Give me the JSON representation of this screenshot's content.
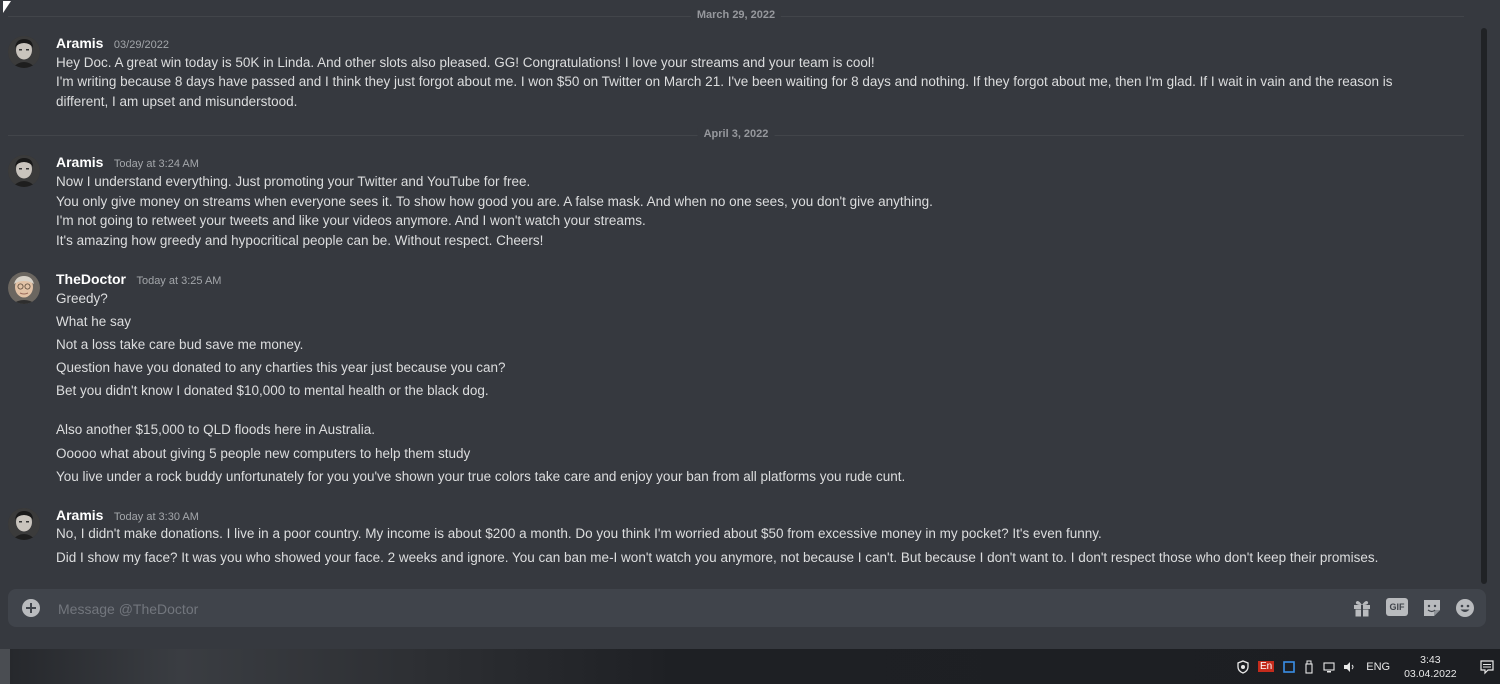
{
  "dividers": [
    "March 29, 2022",
    "April 3, 2022"
  ],
  "messages": [
    {
      "author": "Aramis",
      "timestamp": "03/29/2022",
      "lines": [
        "Hey Doc. A great win today is 50K in Linda. And other slots also pleased. GG! Congratulations! I love your streams and your team is cool!",
        "I'm writing because 8 days have passed and I think they just forgot about me. I won $50 on Twitter on March 21. I've been waiting for 8 days and nothing. If they forgot about me, then I'm glad. If I wait in vain and the reason is different, I am upset and misunderstood."
      ]
    },
    {
      "author": "Aramis",
      "timestamp": "Today at 3:24 AM",
      "lines": [
        "Now I understand everything. Just promoting your Twitter and YouTube for free.",
        "You only give money on streams when everyone sees it. To show how good you are. A false mask. And when no one sees, you don't give anything.",
        "I'm not going to retweet your tweets and like your videos anymore. And I won't watch your streams.",
        "It's amazing how greedy and hypocritical people can be. Without respect. Cheers!"
      ]
    },
    {
      "author": "TheDoctor",
      "timestamp": "Today at 3:25 AM",
      "lines": [
        "Greedy?",
        "What he say",
        "Not a loss take care bud save me money.",
        "Question have you donated to any charties this year just because you can?",
        "Bet you didn't know I donated $10,000 to mental health or the black dog.",
        "Also another $15,000 to QLD floods here in Australia.",
        "Ooooo what about giving 5 people new computers to help them study",
        "You live under a rock buddy unfortunately for you you've shown your true colors take care and enjoy your ban from all platforms you rude cunt."
      ]
    },
    {
      "author": "Aramis",
      "timestamp": "Today at 3:30 AM",
      "lines": [
        "No, I didn't make donations. I live in a poor country. My income is about $200 a month. Do you think I'm worried about $50 from excessive money in my pocket? It's even funny.",
        "Did I show my face? It was you who showed your face. 2 weeks and ignore. You can ban me-I won't watch you anymore, not because I can't. But because I don't want to. I don't respect those who don't keep their promises."
      ]
    }
  ],
  "composer": {
    "placeholder": "Message @TheDoctor",
    "buttons": [
      "gift-icon",
      "gif-icon",
      "sticker-icon",
      "emoji-icon"
    ],
    "gif_label": "GIF"
  },
  "taskbar": {
    "lang_indicator": "En",
    "lang": "ENG",
    "time": "3:43",
    "date": "03.04.2022"
  }
}
